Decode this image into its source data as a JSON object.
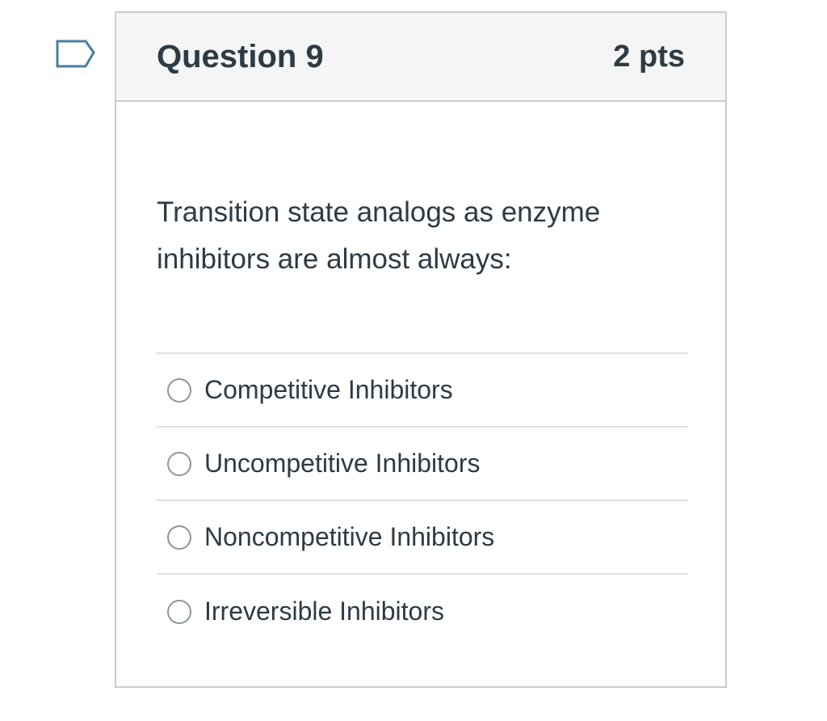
{
  "question": {
    "title": "Question 9",
    "points": "2 pts",
    "text": "Transition state analogs as enzyme inhibitors are almost always:",
    "flag_icon": "flag-outline-icon"
  },
  "answers": [
    {
      "label": "Competitive Inhibitors",
      "selected": false
    },
    {
      "label": "Uncompetitive Inhibitors",
      "selected": false
    },
    {
      "label": "Noncompetitive Inhibitors",
      "selected": false
    },
    {
      "label": "Irreversible Inhibitors",
      "selected": false
    }
  ],
  "colors": {
    "text": "#2d3b45",
    "border": "#c7cdd1",
    "header_bg": "#f5f5f5",
    "flag_stroke": "#2d6e8e"
  }
}
